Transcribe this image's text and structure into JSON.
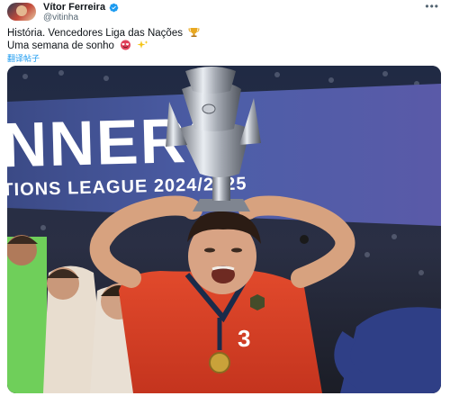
{
  "post": {
    "author": {
      "display_name": "Vítor Ferreira",
      "handle": "@vitinha",
      "verified": true,
      "verified_color": "#1d9bf0"
    },
    "menu_icon": "more-horizontal-icon",
    "text_lines": [
      "História. Vencedores Liga das Nações",
      "Uma semana de sonho"
    ],
    "emojis": [
      "trophy",
      "heart-eyes-face",
      "sparkles"
    ],
    "translate_label": "翻译帖子",
    "media": {
      "banner": {
        "big_text": "NNERS",
        "small_text": "TIONS LEAGUE 2024/2025"
      },
      "jersey_number": "3"
    }
  }
}
